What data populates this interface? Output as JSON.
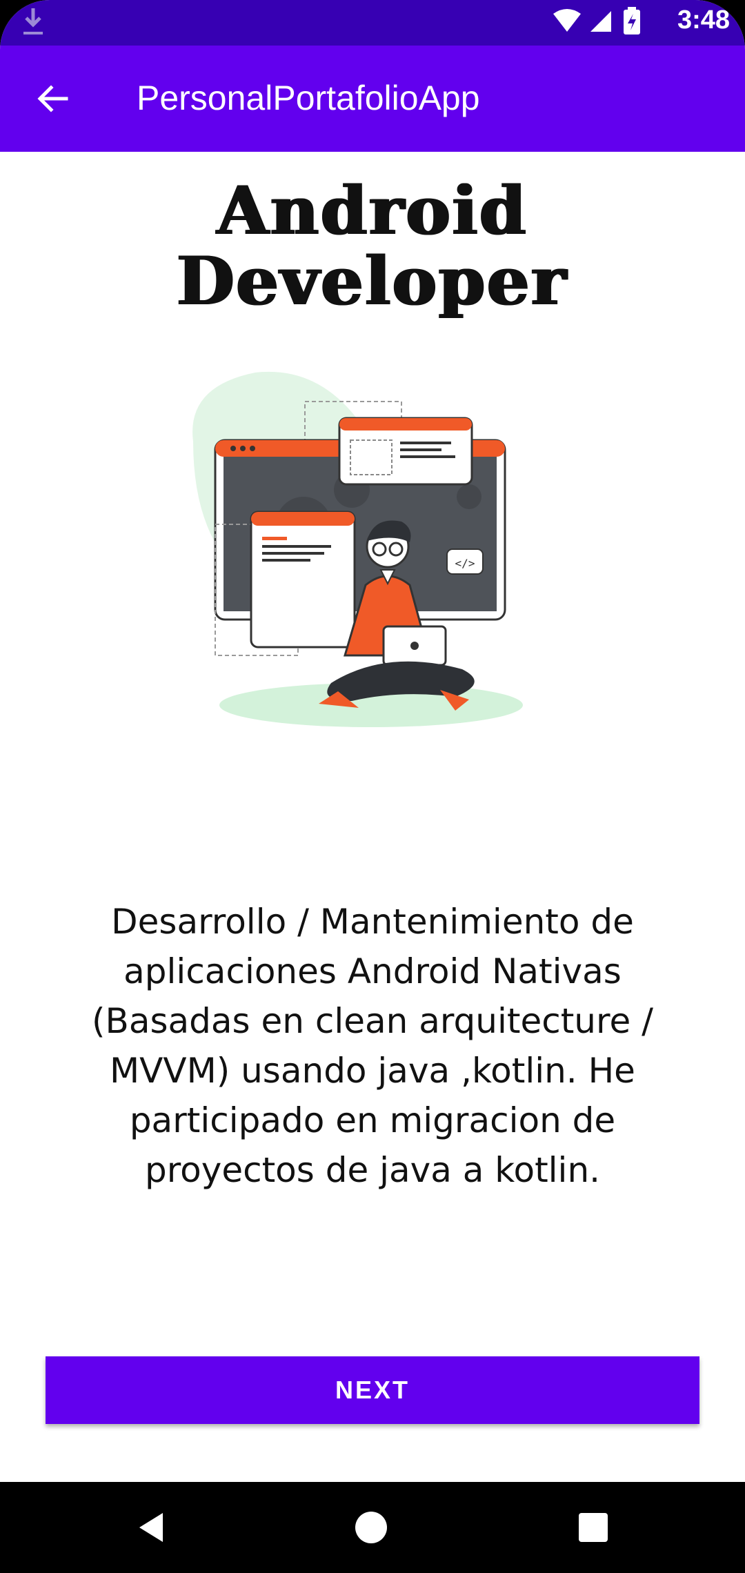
{
  "status_bar": {
    "time": "3:48"
  },
  "app_bar": {
    "title": "PersonalPortafolioApp"
  },
  "headline": {
    "line1": "Android",
    "line2": "Developer"
  },
  "description": "Desarrollo / Mantenimiento de aplicaciones Android Nativas (Basadas en clean arquitecture / MVVM) usando java ,kotlin. He participado en migracion de proyectos de java a kotlin.",
  "next_button": {
    "label": "NEXT"
  },
  "colors": {
    "status_bar": "#3700b3",
    "app_bar": "#6200ee",
    "accent": "#6200ee",
    "illustration_orange": "#f05a28",
    "illustration_green": "#d9f2df"
  },
  "icons": [
    "download-icon",
    "wifi-icon",
    "signal-icon",
    "battery-icon",
    "back-arrow-icon",
    "nav-back-icon",
    "nav-home-icon",
    "nav-recents-icon"
  ]
}
